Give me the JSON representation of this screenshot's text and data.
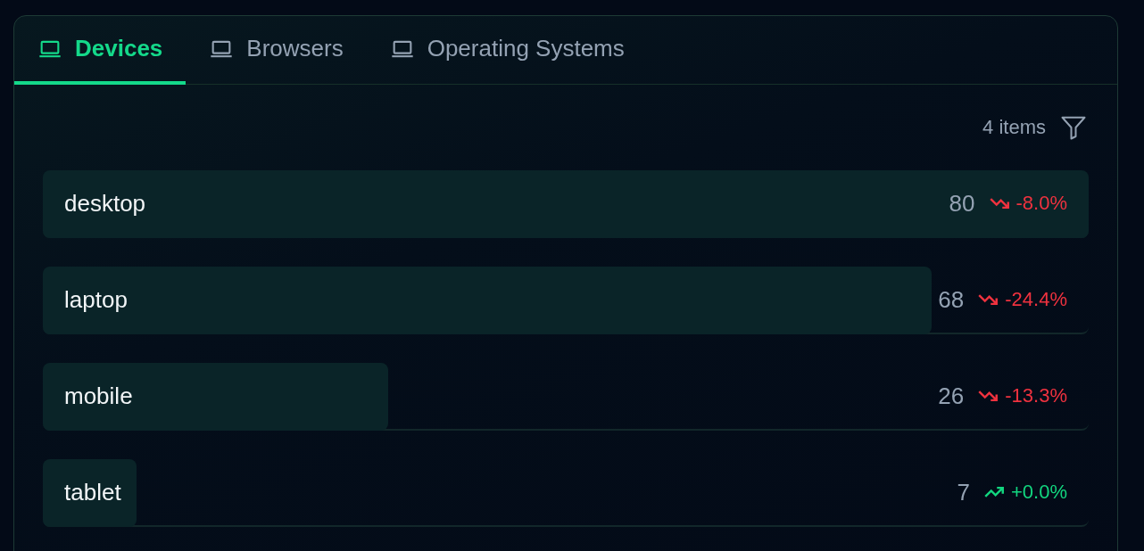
{
  "tabs": [
    {
      "label": "Devices",
      "selected": true
    },
    {
      "label": "Browsers",
      "selected": false
    },
    {
      "label": "Operating Systems",
      "selected": false
    }
  ],
  "item_count": "4 items",
  "rows": [
    {
      "name": "desktop",
      "level": 1.0,
      "value": "80",
      "kind": "down",
      "change": "-8.0%"
    },
    {
      "name": "laptop",
      "level": 0.85,
      "value": "68",
      "kind": "down",
      "change": "-24.4%"
    },
    {
      "name": "mobile",
      "level": 0.33,
      "value": "26",
      "kind": "down",
      "change": "-13.3%"
    },
    {
      "name": "tablet",
      "level": 0.09,
      "value": "7",
      "kind": "up",
      "change": "+0.0%"
    }
  ]
}
